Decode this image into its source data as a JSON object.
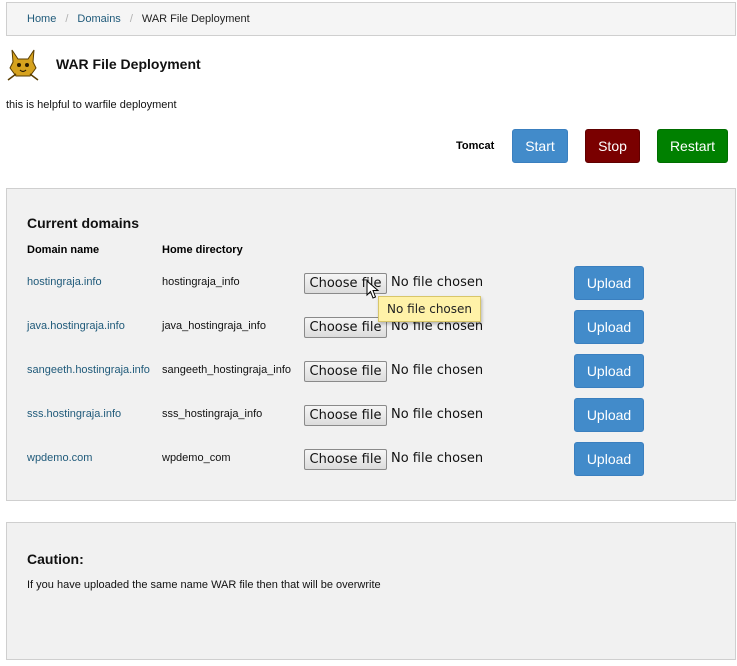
{
  "breadcrumb": {
    "home": "Home",
    "domains": "Domains",
    "current": "WAR File Deployment",
    "separator": "/"
  },
  "header": {
    "title": "WAR File Deployment",
    "description": "this is helpful to warfile deployment",
    "logo_icon": "tomcat-logo-icon"
  },
  "service": {
    "label": "Tomcat",
    "start": "Start",
    "stop": "Stop",
    "restart": "Restart",
    "colors": {
      "start": "#428bca",
      "stop": "#7a0000",
      "restart": "#008000"
    }
  },
  "domains": {
    "title": "Current domains",
    "col_domain": "Domain name",
    "col_home": "Home directory",
    "rows": [
      {
        "domain": "hostingraja.info",
        "home": "hostingraja_info",
        "choose": "Choose file",
        "file": "No file chosen",
        "upload": "Upload"
      },
      {
        "domain": "java.hostingraja.info",
        "home": "java_hostingraja_info",
        "choose": "Choose file",
        "file": "No file chosen",
        "upload": "Upload"
      },
      {
        "domain": "sangeeth.hostingraja.info",
        "home": "sangeeth_hostingraja_info",
        "choose": "Choose file",
        "file": "No file chosen",
        "upload": "Upload"
      },
      {
        "domain": "sss.hostingraja.info",
        "home": "sss_hostingraja_info",
        "choose": "Choose file",
        "file": "No file chosen",
        "upload": "Upload"
      },
      {
        "domain": "wpdemo.com",
        "home": "wpdemo_com",
        "choose": "Choose file",
        "file": "No file chosen",
        "upload": "Upload"
      }
    ]
  },
  "tooltip": {
    "text": "No file chosen"
  },
  "caution": {
    "title": "Caution:",
    "text": "If you have uploaded the same name WAR file then that will be overwrite"
  }
}
